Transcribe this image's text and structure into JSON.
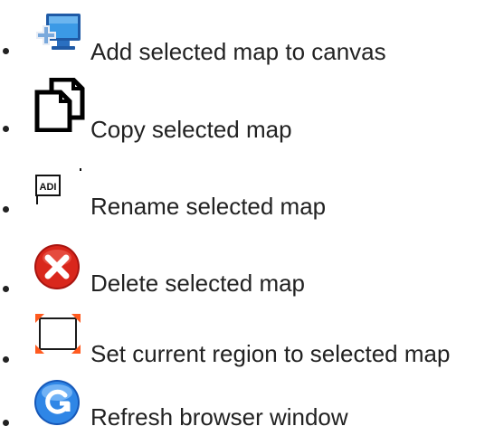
{
  "items": [
    {
      "icon": "add-map-to-canvas-icon",
      "label": "Add selected map to canvas"
    },
    {
      "icon": "copy-map-icon",
      "label": "Copy selected map"
    },
    {
      "icon": "rename-map-icon",
      "label": "Rename selected map",
      "icon_text": "ADI"
    },
    {
      "icon": "delete-map-icon",
      "label": "Delete selected map"
    },
    {
      "icon": "set-region-icon",
      "label": "Set current region to selected map"
    },
    {
      "icon": "refresh-icon",
      "label": "Refresh browser window"
    }
  ],
  "colors": {
    "text": "#222222",
    "monitor_blue": "#2a82d8",
    "delete_red": "#d9271c",
    "region_orange": "#ff5a1f",
    "refresh_blue": "#1c6fd0"
  }
}
